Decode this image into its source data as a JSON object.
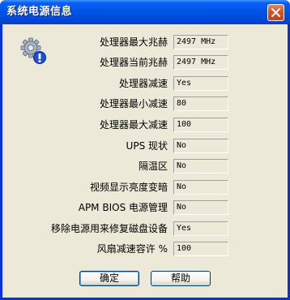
{
  "window": {
    "title": "系统电源信息",
    "close_icon": "close-x-icon"
  },
  "icon": "settings-gear-info-icon",
  "rows": [
    {
      "label": "处理器最大兆赫",
      "value": "2497 MHz"
    },
    {
      "label": "处理器当前兆赫",
      "value": "2497 MHz"
    },
    {
      "label": "处理器减速",
      "value": "Yes"
    },
    {
      "label": "处理器最小减速",
      "value": "80"
    },
    {
      "label": "处理器最大减速",
      "value": "100"
    },
    {
      "label": "UPS 现状",
      "value": "No"
    },
    {
      "label": "隔温区",
      "value": "No"
    },
    {
      "label": "视频显示亮度变暗",
      "value": "No"
    },
    {
      "label": "APM BIOS 电源管理",
      "value": "No"
    },
    {
      "label": "移除电源用来修复磁盘设备",
      "value": "Yes"
    },
    {
      "label": "风扇减速容许 %",
      "value": "100"
    }
  ],
  "buttons": {
    "ok": "确定",
    "help": "帮助"
  }
}
